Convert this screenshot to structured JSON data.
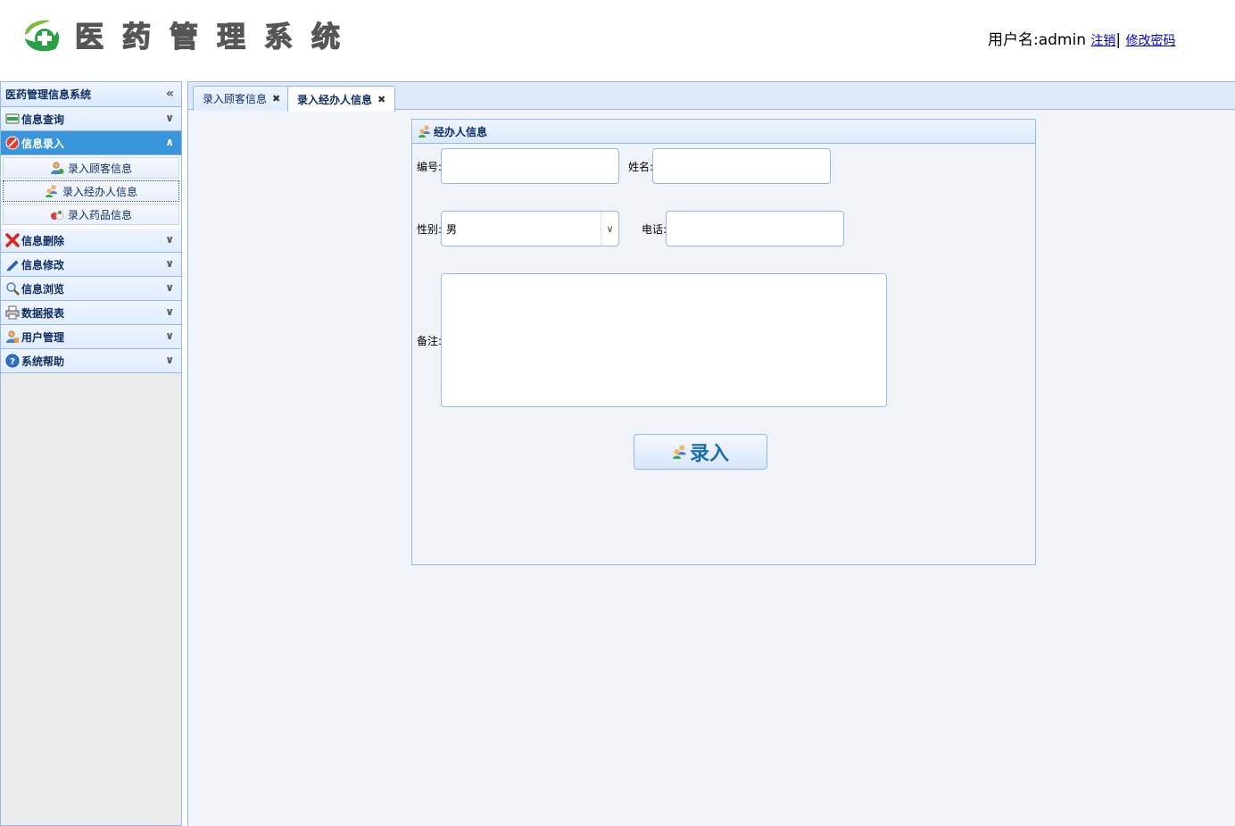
{
  "header": {
    "logo_chars": [
      "医",
      "药",
      "管",
      "理",
      "系",
      "统"
    ],
    "user_label": "用户名:admin",
    "logout_link": "注销",
    "separator": "|",
    "change_password_link": "修改密码"
  },
  "sidebar": {
    "title": "医药管理信息系统",
    "groups": [
      {
        "label": "信息查询",
        "icon": "card-icon",
        "expanded": false
      },
      {
        "label": "信息录入",
        "icon": "no-entry-icon",
        "expanded": true,
        "items": [
          {
            "label": "录入顾客信息",
            "icon": "user-icon"
          },
          {
            "label": "录入经办人信息",
            "icon": "users-icon"
          },
          {
            "label": "录入药品信息",
            "icon": "pills-icon"
          }
        ]
      },
      {
        "label": "信息删除",
        "icon": "red-x-icon",
        "expanded": false
      },
      {
        "label": "信息修改",
        "icon": "pencil-icon",
        "expanded": false
      },
      {
        "label": "信息浏览",
        "icon": "magnifier-icon",
        "expanded": false
      },
      {
        "label": "数据报表",
        "icon": "printer-icon",
        "expanded": false
      },
      {
        "label": "用户管理",
        "icon": "user-manage-icon",
        "expanded": false
      },
      {
        "label": "系统帮助",
        "icon": "help-icon",
        "expanded": false
      }
    ]
  },
  "tabs": [
    {
      "label": "录入顾客信息",
      "active": false
    },
    {
      "label": "录入经办人信息",
      "active": true
    }
  ],
  "form": {
    "panel_title": "经办人信息",
    "id_label": "编号:",
    "id_value": "",
    "name_label": "姓名:",
    "name_value": "",
    "gender_label": "性别:",
    "gender_value": "男",
    "phone_label": "电话:",
    "phone_value": "",
    "note_label": "备注:",
    "note_value": "",
    "submit_label": "录入"
  },
  "colors": {
    "active_header": "#3a96da",
    "border": "#95b8e7",
    "text_dark": "#0e2d5f",
    "button_text": "#1d6fa8"
  }
}
